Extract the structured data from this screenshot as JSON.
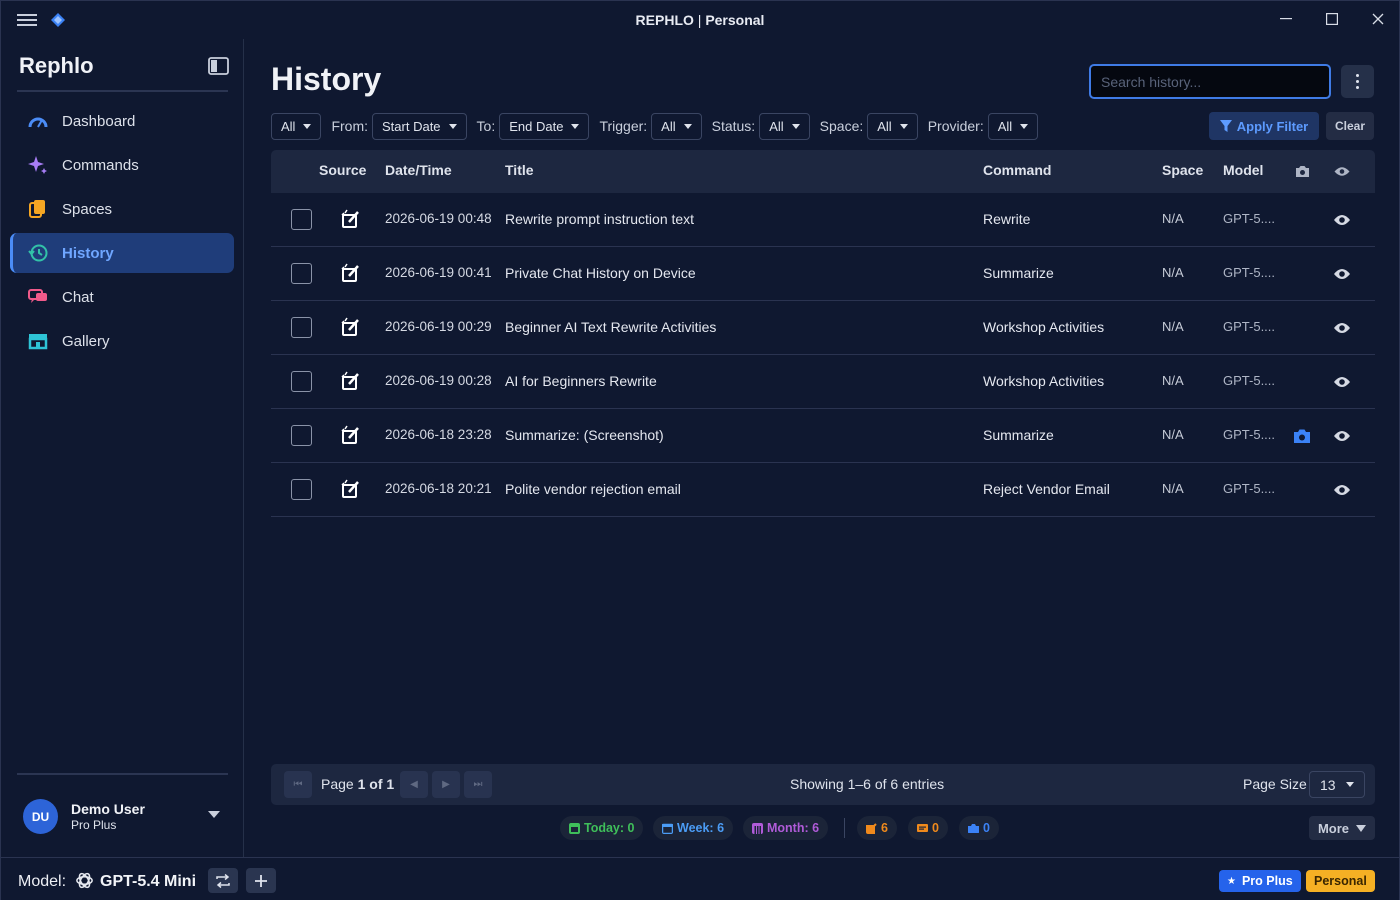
{
  "window": {
    "app_name": "REPHLO",
    "workspace": "Personal",
    "separator": "|"
  },
  "sidebar": {
    "brand": "Rephlo",
    "items": [
      {
        "label": "Dashboard",
        "icon": "dashboard-gauge-icon",
        "color": "#4b8cf6"
      },
      {
        "label": "Commands",
        "icon": "sparkle-icon",
        "color": "#a77df5"
      },
      {
        "label": "Spaces",
        "icon": "spaces-stack-icon",
        "color": "#f5a623"
      },
      {
        "label": "History",
        "icon": "history-clock-icon",
        "color": "#32c2a8",
        "active": true
      },
      {
        "label": "Chat",
        "icon": "chat-bubbles-icon",
        "color": "#f05a8a"
      },
      {
        "label": "Gallery",
        "icon": "gallery-store-icon",
        "color": "#2ec4d6"
      }
    ],
    "user": {
      "initials": "DU",
      "name": "Demo User",
      "plan": "Pro Plus"
    }
  },
  "main": {
    "title": "History",
    "search_placeholder": "Search history...",
    "filters": {
      "all_label": "All",
      "from_label": "From:",
      "start_date": "Start Date",
      "to_label": "To:",
      "end_date": "End Date",
      "trigger_label": "Trigger:",
      "trigger_value": "All",
      "status_label": "Status:",
      "status_value": "All",
      "space_label": "Space:",
      "space_value": "All",
      "provider_label": "Provider:",
      "provider_value": "All",
      "apply": "Apply Filter",
      "clear": "Clear"
    },
    "table": {
      "columns": {
        "source": "Source",
        "datetime": "Date/Time",
        "title": "Title",
        "command": "Command",
        "space": "Space",
        "model": "Model"
      },
      "rows": [
        {
          "datetime": "2026-06-19 00:48",
          "title": "Rewrite prompt instruction text",
          "command": "Rewrite",
          "space": "N/A",
          "model": "GPT-5....",
          "screenshot": false
        },
        {
          "datetime": "2026-06-19 00:41",
          "title": "Private Chat History on Device",
          "command": "Summarize",
          "space": "N/A",
          "model": "GPT-5....",
          "screenshot": false
        },
        {
          "datetime": "2026-06-19 00:29",
          "title": "Beginner AI Text Rewrite Activities",
          "command": "Workshop Activities",
          "space": "N/A",
          "model": "GPT-5....",
          "screenshot": false
        },
        {
          "datetime": "2026-06-19 00:28",
          "title": "AI for Beginners Rewrite",
          "command": "Workshop Activities",
          "space": "N/A",
          "model": "GPT-5....",
          "screenshot": false
        },
        {
          "datetime": "2026-06-18 23:28",
          "title": "Summarize: (Screenshot)",
          "command": "Summarize",
          "space": "N/A",
          "model": "GPT-5....",
          "screenshot": true
        },
        {
          "datetime": "2026-06-18 20:21",
          "title": "Polite vendor rejection email",
          "command": "Reject Vendor Email",
          "space": "N/A",
          "model": "GPT-5....",
          "screenshot": false
        }
      ]
    },
    "pagination": {
      "page_label": "Page",
      "page_value": "1 of 1",
      "showing": "Showing 1–6 of 6 entries",
      "page_size_label": "Page Size",
      "page_size": "13"
    },
    "stats": {
      "today": "Today: 0",
      "week": "Week: 6",
      "month": "Month: 6",
      "commands_count": "6",
      "chat_count": "0",
      "screenshot_count": "0",
      "more": "More",
      "colors": {
        "today": "#3fbf5a",
        "week": "#4b9cf5",
        "month": "#b05bd8",
        "orange": "#f08a1c",
        "blue": "#3b82f6"
      }
    }
  },
  "bottombar": {
    "model_label": "Model:",
    "model_name": "GPT-5.4 Mini",
    "tier_badge": "Pro Plus",
    "workspace_badge": "Personal"
  }
}
